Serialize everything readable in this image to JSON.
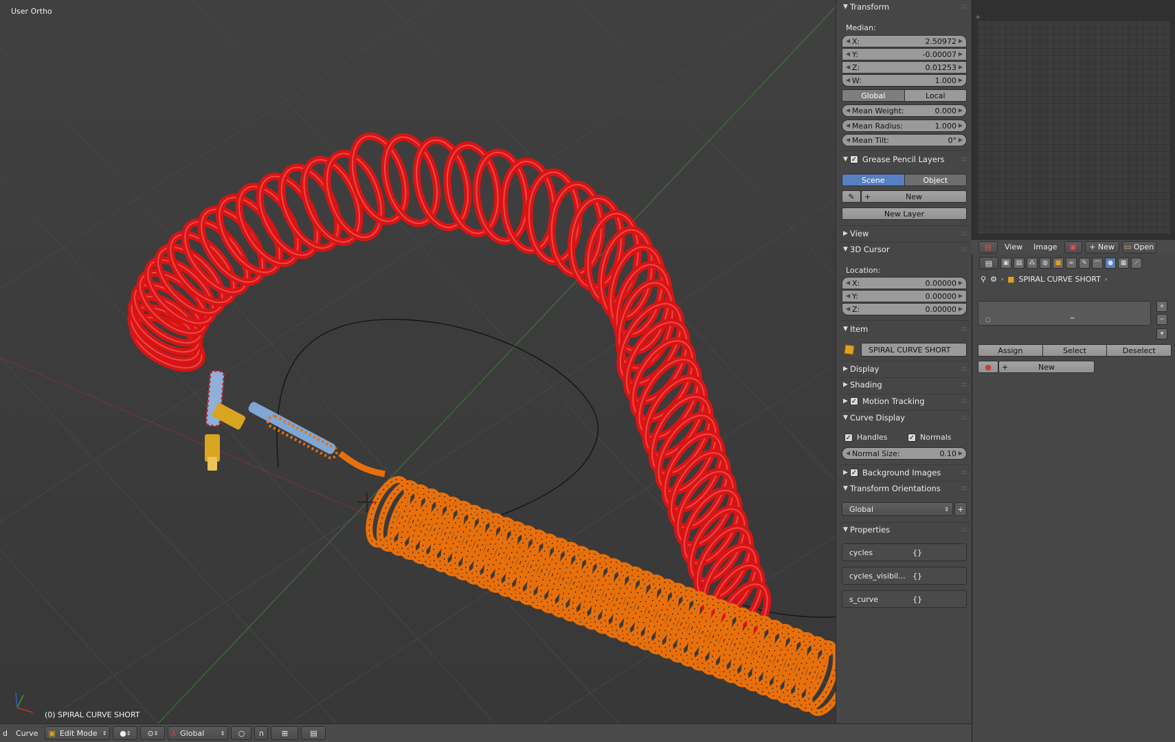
{
  "viewport": {
    "view_label": "User Ortho",
    "object_label": "(0) SPIRAL CURVE SHORT"
  },
  "header": {
    "left_glyph": "d",
    "menu_curve": "Curve",
    "mode": "Edit Mode",
    "orientation": "Global"
  },
  "npanel": {
    "transform": {
      "title": "Transform",
      "median_label": "Median:",
      "x_label": "X:",
      "x": "2.50972",
      "y_label": "Y:",
      "y": "-0.00007",
      "z_label": "Z:",
      "z": "0.01253",
      "w_label": "W:",
      "w": "1.000",
      "global": "Global",
      "local": "Local",
      "mean_weight_label": "Mean Weight:",
      "mean_weight": "0.000",
      "mean_radius_label": "Mean Radius:",
      "mean_radius": "1.000",
      "mean_tilt_label": "Mean Tilt:",
      "mean_tilt": "0°"
    },
    "grease": {
      "title": "Grease Pencil Layers",
      "scene": "Scene",
      "object": "Object",
      "new": "New",
      "new_layer": "New Layer"
    },
    "view": {
      "title": "View"
    },
    "cursor": {
      "title": "3D Cursor",
      "location_label": "Location:",
      "x_label": "X:",
      "x": "0.00000",
      "y_label": "Y:",
      "y": "0.00000",
      "z_label": "Z:",
      "z": "0.00000"
    },
    "item": {
      "title": "Item",
      "name": "SPIRAL CURVE SHORT"
    },
    "display": {
      "title": "Display"
    },
    "shading": {
      "title": "Shading"
    },
    "motion_tracking": {
      "title": "Motion Tracking"
    },
    "curve_display": {
      "title": "Curve Display",
      "handles": "Handles",
      "normals": "Normals",
      "normal_size_label": "Normal Size:",
      "normal_size": "0.10"
    },
    "background_images": {
      "title": "Background Images"
    },
    "transform_orientations": {
      "title": "Transform Orientations",
      "value": "Global"
    },
    "properties": {
      "title": "Properties",
      "items": [
        {
          "name": "cycles",
          "value": "{}"
        },
        {
          "name": "cycles_visibil...",
          "value": "{}"
        },
        {
          "name": "s_curve",
          "value": "{}"
        }
      ]
    }
  },
  "image_editor": {
    "view": "View",
    "image": "Image",
    "new": "New",
    "open": "Open"
  },
  "props_editor": {
    "breadcrumb": "SPIRAL CURVE SHORT",
    "assign": "Assign",
    "select": "Select",
    "deselect": "Deselect",
    "new": "New"
  },
  "colors": {
    "red_coil": "#d81414",
    "orange_coil": "#e8700a",
    "accent_blue": "#5680c2"
  }
}
